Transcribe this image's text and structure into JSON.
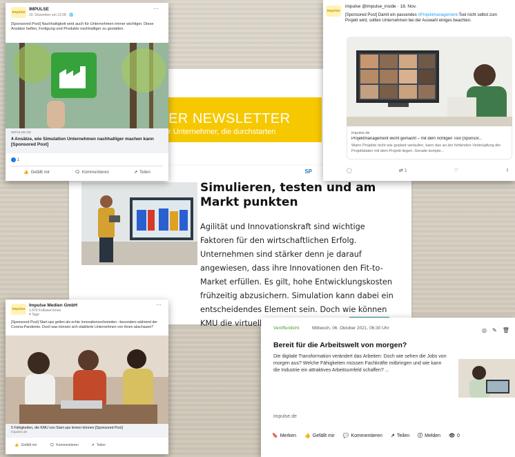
{
  "newsletter": {
    "title": "ER NEWSLETTER",
    "subtitle": "r Unternehmer, die durchstarten"
  },
  "article": {
    "sponsor_tag": "SP",
    "title": "Simulieren, testen und am Markt punkten",
    "body": "Agilität und Innovationskraft sind wichtige Faktoren für den wirtschaftlichen Erfolg. Unternehmen sind stärker denn je darauf angewiesen, dass ihre Innovationen den Fit-to-Market erfüllen. Es gilt, hohe Entwicklungskosten frühzeitig abzusichern. Simulation kann dabei ein entscheidendes Element sein. Doch wie können KMU die virtuelle Welt für sich nutzen?"
  },
  "fb_post_1": {
    "logo": "impulse",
    "page_name": "IMPULSE",
    "meta": "10. Dezember um 13:28 · 🌐",
    "text": "[Sponsored Post] Nachhaltigkeit wird auch für Unternehmen immer wichtiger. Diese Ansätze helfen, Fertigung und Produkte nachhaltiger zu gestalten.",
    "domain": "IMPULSE.DE",
    "link_title": "4 Ansätze, wie Simulation Unternehmen nachhaltiger machen kann [Sponsored Post]",
    "reactions": "1",
    "like": "Gefällt mir",
    "comment": "Kommentieren",
    "share": "Teilen"
  },
  "tweet": {
    "logo": "impulse",
    "handle": "impulse @impulse_inside · 18. Nov.",
    "text_before": "[Sponsored Post] Damit ein passendes ",
    "hashtag": "#Projektmanagement",
    "text_after": "-Tool nicht selbst zum Projekt wird, sollten Unternehmen bei der Auswahl einiges beachten.",
    "domain": "impulse.de",
    "link_title": "Projektmanagement leicht gemacht – mit dem richtigen Tool [Sponsor...",
    "link_desc": "Wann Projekte nicht wie geplant verlaufen, kann das an der fehlenden Verknüpfung der Projektdaten mit dem Projekt liegen. Gerade komple...",
    "retweets": "1"
  },
  "fb_post_2": {
    "logo": "impulse",
    "page_name": "Impulse Medien GmbH",
    "followers": "1.870 Follower:innen",
    "age": "4 Tage",
    "text": "[Sponsored Post] Start-ups gelten als echte Innovationsschmieden –besonders während der Corona-Pandemie. Doch was können sich etablierte Unternehmen von ihnen abschauen?",
    "link_title": "5 Fähigkeiten, die KMU von Start-ups lernen können [Sponsored Post]",
    "domain": "impulse.de",
    "like": "Gefällt mir",
    "comment": "Kommentieren",
    "share": "Teilen"
  },
  "xing_post": {
    "published": "Veröffentlicht",
    "date": "Mittwoch, 06. Oktober 2021, 06:30 Uhr",
    "title": "Bereit für die Arbeitswelt von morgen?",
    "desc": "Die digitale Transformation verändert das Arbeiten: Doch wie sehen die Jobs von morgen aus? Welche Fähigkeiten müssen Fachkräfte mitbringen und wie kann die Industrie ein attraktives Arbeitsumfeld schaffen? ...",
    "domain": "impulse.de",
    "bookmark": "Merken",
    "like": "Gefällt mir",
    "comment": "Kommentieren",
    "share": "Teilen",
    "report": "Melden",
    "views": "0"
  }
}
